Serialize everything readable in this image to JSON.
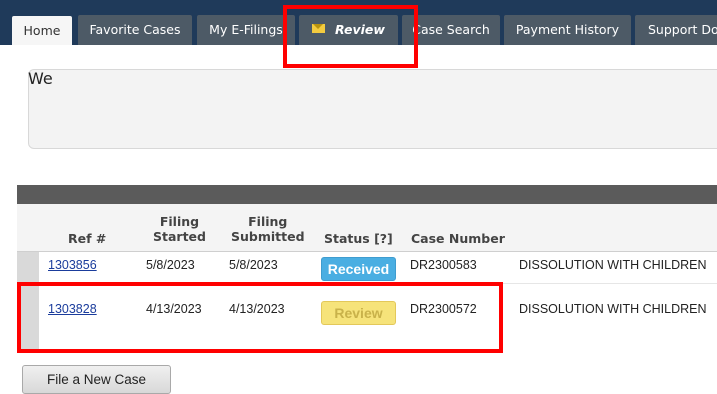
{
  "nav": {
    "tabs": [
      {
        "label": "Home",
        "active": true
      },
      {
        "label": "Favorite Cases"
      },
      {
        "label": "My E-Filings"
      },
      {
        "label": "Review",
        "icon": "mail-icon"
      },
      {
        "label": "Case Search"
      },
      {
        "label": "Payment History"
      },
      {
        "label": "Support Do"
      }
    ]
  },
  "welcome": {
    "text": "We"
  },
  "table": {
    "headers": {
      "ref": "Ref #",
      "filing_started": [
        "Filing",
        "Started"
      ],
      "filing_submitted": [
        "Filing",
        "Submitted"
      ],
      "status": "Status [?]",
      "case_number": "Case Number"
    },
    "rows": [
      {
        "ref": "1303856",
        "started": "5/8/2023",
        "submitted": "5/8/2023",
        "status": "Received",
        "case_number": "DR2300583",
        "case_type": "DISSOLUTION WITH CHILDREN"
      },
      {
        "ref": "1303828",
        "started": "4/13/2023",
        "submitted": "4/13/2023",
        "status": "Review",
        "case_number": "DR2300572",
        "case_type": "DISSOLUTION WITH CHILDREN"
      }
    ]
  },
  "actions": {
    "new_case": "File a New Case"
  },
  "colors": {
    "nav_bg": "#1f3a5a",
    "tab_bg": "#4d5a66",
    "badge_received": "#4aaee2",
    "badge_review": "#f6e37a",
    "highlight": "#ff0000"
  }
}
